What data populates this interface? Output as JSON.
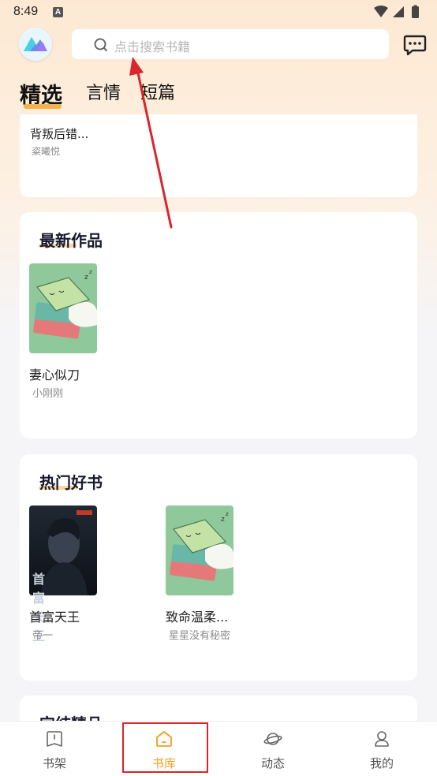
{
  "status_bar": {
    "time": "8:49",
    "notification_badge": "A"
  },
  "header": {
    "search_placeholder": "点击搜索书籍"
  },
  "tabs": [
    {
      "label": "精选",
      "active": true
    },
    {
      "label": "言情",
      "active": false
    },
    {
      "label": "短篇",
      "active": false
    }
  ],
  "top_card_book": {
    "title": "背叛后错...",
    "author": "粢曦悦"
  },
  "sections": {
    "newest": {
      "title": "最新作品",
      "books": [
        {
          "title": "妻心似刀",
          "author": "小刚刚",
          "cover": "placeholder-books"
        }
      ]
    },
    "hot": {
      "title": "热门好书",
      "books": [
        {
          "title": "首富天王",
          "author": "帝一",
          "cover": "dark-portrait",
          "cover_text": "首富天王"
        },
        {
          "title": "致命温柔...",
          "author": "星星没有秘密",
          "cover": "placeholder-books"
        }
      ]
    },
    "finished": {
      "title": "完结精品"
    }
  },
  "bottom_nav": [
    {
      "label": "书架",
      "icon": "bookshelf-icon",
      "active": false
    },
    {
      "label": "书库",
      "icon": "library-house-icon",
      "active": true
    },
    {
      "label": "动态",
      "icon": "planet-icon",
      "active": false
    },
    {
      "label": "我的",
      "icon": "profile-icon",
      "active": false
    }
  ],
  "colors": {
    "accent": "#f29d1f",
    "annotation": "#d9252b",
    "tab_underline": "#f6b24a"
  }
}
